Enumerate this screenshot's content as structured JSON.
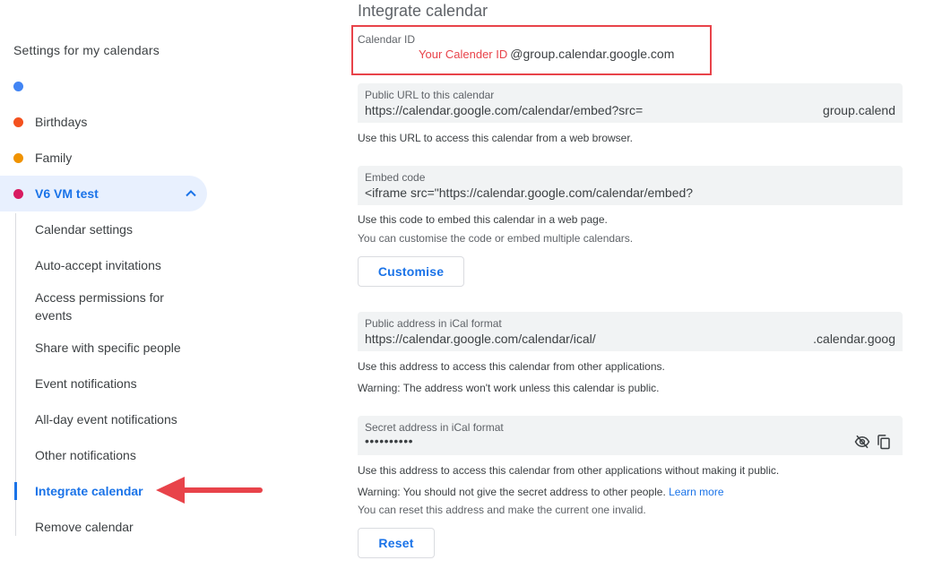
{
  "sidebar": {
    "heading": "Settings for my calendars",
    "calendars": [
      {
        "label": "",
        "color": "#4285f4"
      },
      {
        "label": "Birthdays",
        "color": "#f4511e"
      },
      {
        "label": "Family",
        "color": "#f09300"
      },
      {
        "label": "V6 VM test",
        "color": "#d81b60",
        "active": true
      }
    ],
    "sub_items": [
      {
        "label": "Calendar settings"
      },
      {
        "label": "Auto-accept invitations"
      },
      {
        "label": "Access permissions for events"
      },
      {
        "label": "Share with specific people"
      },
      {
        "label": "Event notifications"
      },
      {
        "label": "All-day event notifications"
      },
      {
        "label": "Other notifications"
      },
      {
        "label": "Integrate calendar",
        "active": true
      },
      {
        "label": "Remove calendar"
      }
    ]
  },
  "main": {
    "title": "Integrate calendar",
    "calendar_id": {
      "label": "Calendar ID",
      "placeholder_annotation": "Your Calender ID",
      "suffix": "@group.calendar.google.com"
    },
    "public_url": {
      "label": "Public URL to this calendar",
      "value": "https://calendar.google.com/calendar/embed?src=",
      "value_end": "group.calend",
      "help": "Use this URL to access this calendar from a web browser."
    },
    "embed_code": {
      "label": "Embed code",
      "value": "<iframe src=\"https://calendar.google.com/calendar/embed?",
      "help": "Use this code to embed this calendar in a web page.",
      "help2": "You can customise the code or embed multiple calendars."
    },
    "customise_button": "Customise",
    "ical_public": {
      "label": "Public address in iCal format",
      "value": "https://calendar.google.com/calendar/ical/",
      "value_end": ".calendar.goog",
      "help": "Use this address to access this calendar from other applications.",
      "warning": "Warning: The address won't work unless this calendar is public."
    },
    "ical_secret": {
      "label": "Secret address in iCal format",
      "value": "••••••••••",
      "help": "Use this address to access this calendar from other applications without making it public.",
      "warning": "Warning: You should not give the secret address to other people.",
      "learn_more": "Learn more",
      "reset_note": "You can reset this address and make the current one invalid."
    },
    "reset_button": "Reset"
  },
  "colors": {
    "accent": "#1a73e8",
    "annotation_red": "#e8434a",
    "active_bg": "#e8f0fe"
  }
}
